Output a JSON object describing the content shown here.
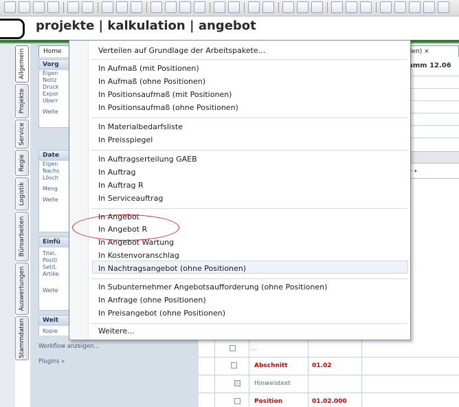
{
  "app": {
    "title": "projekte | kalkulation | angebot"
  },
  "vertical_tabs": [
    "Allgemein",
    "Projekte",
    "Service",
    "Regie",
    "Logistik",
    "Büroarbeiten",
    "Auswertungen",
    "Stammdaten"
  ],
  "task_pane": {
    "home_tab": "Home",
    "sections": [
      {
        "title": "Vorg",
        "items": [
          "Eigen",
          "Notiz",
          "Druck",
          "Expor",
          "Überr"
        ],
        "more": "Weite"
      },
      {
        "title": "Date",
        "items": [
          "Eigen",
          "Nachs",
          "Lösch"
        ],
        "extra": "Meng",
        "more": "Weite"
      },
      {
        "title": "Einfü",
        "items": [
          "Titel.",
          "Positi",
          "Set/L",
          "Artike"
        ],
        "more": "Weite"
      },
      {
        "title": "Weit",
        "items": [
          "Kopie"
        ]
      }
    ],
    "links": {
      "workflow": "Workflow anzeigen...",
      "plugins": "Plugins »"
    }
  },
  "document": {
    "tab_label": "ien) ×",
    "header": "amm 12.06",
    "column_header": "r *",
    "rows": [
      {
        "type": "Abschnitt",
        "number": "01.02"
      },
      {
        "type": "Hinweistext",
        "number": ""
      },
      {
        "type": "Position",
        "number": "01.02.000"
      }
    ],
    "ellipsis": "..."
  },
  "context_menu": {
    "items": [
      "Verteilen auf Grundlage der Arbeitspakete...",
      "In Aufmaß (mit Positionen)",
      "In Aufmaß (ohne Positionen)",
      "In Positionsaufmaß (mit Positionen)",
      "In Positionsaufmaß (ohne Positionen)",
      "In Materialbedarfsliste",
      "In Preisspiegel",
      "In Auftragserteilung GAEB",
      "In Auftrag",
      "In Auftrag R",
      "In Serviceauftrag",
      "In Angebot",
      "In Angebot R",
      "In Angebot Wartung",
      "In Kostenvoranschlag",
      "In Nachtragsangebot (ohne Positionen)",
      "In Subunternehmer Angebotsaufforderung (ohne Positionen)",
      "In Anfrage (ohne Positionen)",
      "In Preisangebot (ohne Positionen)",
      "Weitere..."
    ],
    "highlighted": "In Angebot R"
  },
  "colors": {
    "accent_green": "#2f7d32",
    "annotation_red": "#d32020",
    "row_red": "#cc0000",
    "row_green": "#2e8b2e",
    "link_blue": "#3f5f86"
  }
}
